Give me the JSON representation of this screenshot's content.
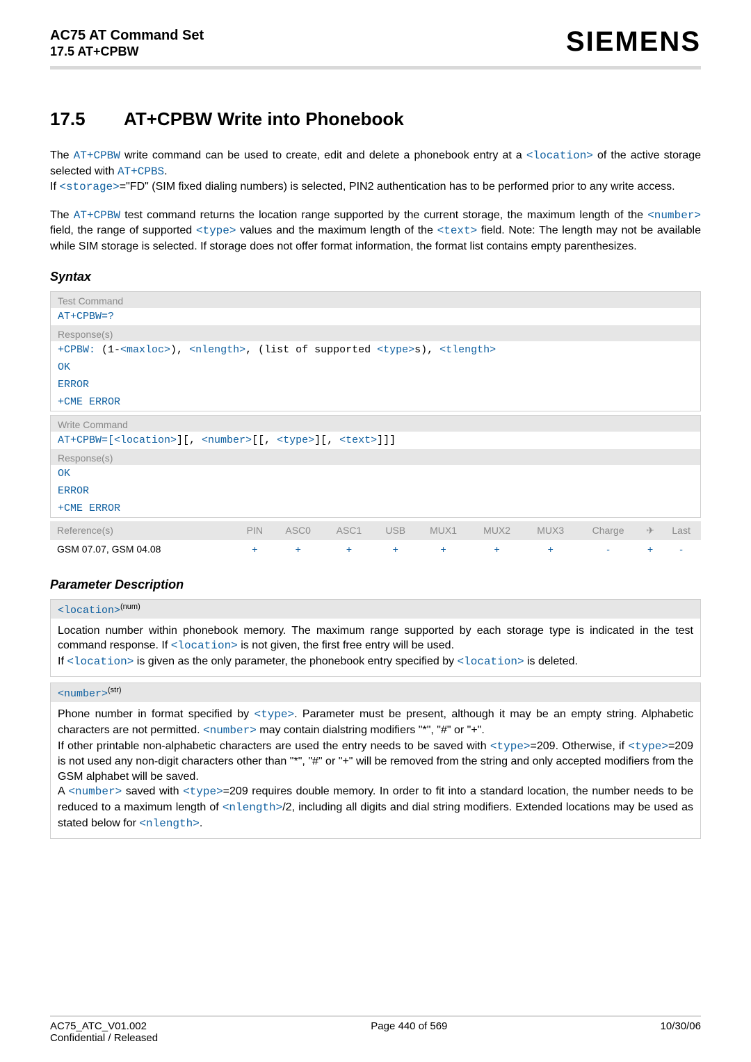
{
  "header": {
    "line1": "AC75 AT Command Set",
    "line2": "17.5 AT+CPBW",
    "brand": "SIEMENS"
  },
  "title": {
    "num": "17.5",
    "text": "AT+CPBW   Write into Phonebook"
  },
  "intro1_parts": {
    "a": "The ",
    "cmd1": "AT+CPBW",
    "b": " write command can be used to create, edit and delete a phonebook entry at a ",
    "cmd2": "<location>",
    "c": " of the active storage selected with ",
    "cmd3": "AT+CPBS",
    "d": "."
  },
  "intro1b_parts": {
    "a": "If ",
    "cmd": "<storage>",
    "b": "=\"FD\" (SIM fixed dialing numbers) is selected, PIN2 authentication has to be performed prior to any write access."
  },
  "intro2_parts": {
    "a": "The ",
    "cmd1": "AT+CPBW",
    "b": " test command returns the location range supported by the current storage, the maximum length of the ",
    "cmd2": "<number>",
    "c": " field, the range of supported ",
    "cmd3": "<type>",
    "d": " values and the maximum length of the ",
    "cmd4": "<text>",
    "e": " field. Note: The length may not be available while SIM storage is selected. If storage does not offer format information, the format list contains empty parenthesizes."
  },
  "syntax_label": "Syntax",
  "testcmd": {
    "label": "Test Command",
    "line": "AT+CPBW=?",
    "resp_label": "Response(s)",
    "resp_prefix": "+CPBW: ",
    "resp_body": {
      "a": "(1-",
      "maxloc": "<maxloc>",
      "b": "), ",
      "nlength": "<nlength>",
      "c": ", (list of supported ",
      "type": "<type>",
      "d": "s), ",
      "tlength": "<tlength>"
    },
    "ok": "OK",
    "err": "ERROR",
    "cme": "+CME ERROR"
  },
  "writecmd": {
    "label": "Write Command",
    "line": {
      "pre": "AT+CPBW=[",
      "loc": "<location>",
      "a": "][, ",
      "num": "<number>",
      "b": "[[, ",
      "typ": "<type>",
      "c": "][, ",
      "txt": "<text>",
      "d": "]]]"
    },
    "resp_label": "Response(s)",
    "ok": "OK",
    "err": "ERROR",
    "cme": "+CME ERROR"
  },
  "reftable": {
    "ref_label": "Reference(s)",
    "cols": [
      "PIN",
      "ASC0",
      "ASC1",
      "USB",
      "MUX1",
      "MUX2",
      "MUX3",
      "Charge",
      "✈",
      "Last"
    ],
    "ref_value": "GSM 07.07, GSM 04.08",
    "vals": [
      "+",
      "+",
      "+",
      "+",
      "+",
      "+",
      "+",
      "-",
      "+",
      "-"
    ]
  },
  "pdesc_label": "Parameter Description",
  "location_param": {
    "tag": "<location>",
    "sup": "(num)",
    "body_parts": {
      "a": "Location number within phonebook memory. The maximum range supported by each storage type is indicated in the test command response. If ",
      "cmd1": "<location>",
      "b": " is not given, the first free entry will be used.",
      "c": "If ",
      "cmd2": "<location>",
      "d": " is given as the only parameter, the phonebook entry specified by ",
      "cmd3": "<location>",
      "e": " is deleted."
    }
  },
  "number_param": {
    "tag": "<number>",
    "sup": "(str)",
    "body_parts": {
      "a": "Phone number in format specified by ",
      "type1": "<type>",
      "b": ". Parameter must be present, although it may be an empty string. Alphabetic characters are not permitted. ",
      "num1": "<number>",
      "c": " may contain dialstring modifiers \"*\", \"#\" or \"+\".",
      "d": "If other printable non-alphabetic characters are used the entry needs to be saved with ",
      "type2": "<type>",
      "e": "=209. Otherwise, if ",
      "type3": "<type>",
      "f": "=209 is not used any non-digit characters other than \"*\", \"#\" or \"+\" will be removed from the string and only accepted modifiers from the GSM alphabet will be saved.",
      "g": "A ",
      "num2": "<number>",
      "h": " saved with ",
      "type4": "<type>",
      "i": "=209 requires double memory. In order to fit into a standard location, the number needs to be reduced to a maximum length of ",
      "nlen1": "<nlength>",
      "j": "/2, including all digits and dial string modifiers. Extended locations may be used as stated below for ",
      "nlen2": "<nlength>",
      "k": "."
    }
  },
  "footer": {
    "left": "AC75_ATC_V01.002",
    "center": "Page 440 of 569",
    "right": "10/30/06",
    "left2": "Confidential / Released"
  }
}
